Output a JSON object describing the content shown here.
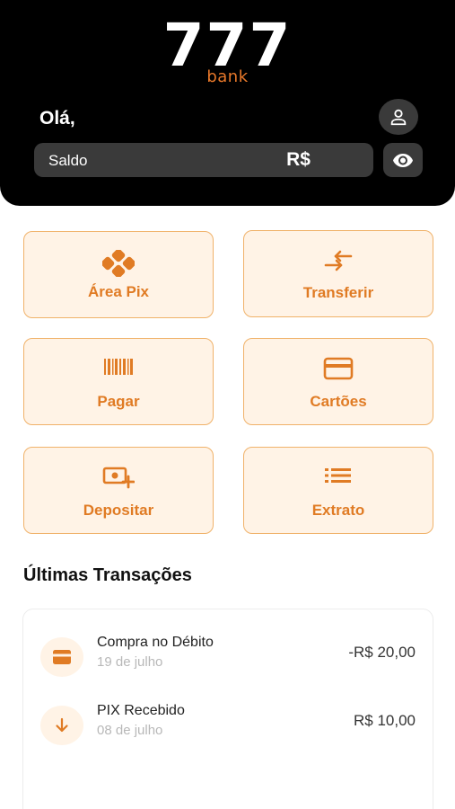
{
  "header": {
    "logo_number": "777",
    "logo_sub": "bank",
    "greeting": "Olá,",
    "balance_label": "Saldo",
    "balance_value": "R$"
  },
  "actions": [
    {
      "label": "Área Pix",
      "icon": "pix-icon"
    },
    {
      "label": "Transferir",
      "icon": "transfer-arrows-icon"
    },
    {
      "label": "Pagar",
      "icon": "barcode-icon"
    },
    {
      "label": "Cartões",
      "icon": "credit-card-icon"
    },
    {
      "label": "Depositar",
      "icon": "deposit-cash-icon"
    },
    {
      "label": "Extrato",
      "icon": "list-icon"
    }
  ],
  "transactions": {
    "title": "Últimas Transações",
    "items": [
      {
        "title": "Compra no Débito",
        "date": "19 de julho",
        "amount": "-R$ 20,00",
        "icon": "credit-card-icon"
      },
      {
        "title": "PIX Recebido",
        "date": "08 de julho",
        "amount": "R$ 10,00",
        "icon": "arrow-down-icon"
      }
    ]
  },
  "colors": {
    "accent": "#e07b24",
    "accent_light": "#fff3e6",
    "header_bg": "#000000",
    "chip_bg": "#3a3a3a"
  }
}
